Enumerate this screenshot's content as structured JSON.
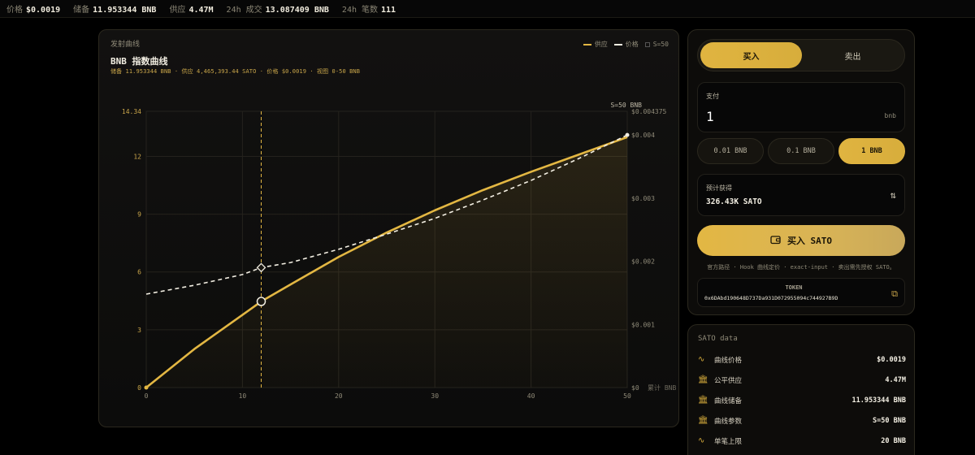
{
  "ticker": [
    {
      "label": "价格",
      "value": "$0.0019"
    },
    {
      "label": "储备",
      "value": "11.953344 BNB"
    },
    {
      "label": "供应",
      "value": "4.47M"
    },
    {
      "label": "24h 成交",
      "value": "13.087409 BNB"
    },
    {
      "label": "24h 笔数",
      "value": "111"
    }
  ],
  "chart_panel": {
    "tag": "发射曲线",
    "title": "BNB 指数曲线",
    "subtitle": "储备 11.953344 BNB · 供应 4,465,393.44 SATO · 价格 $0.0019 · 视图 0-50 BNB",
    "legend": {
      "supply": "供应",
      "price": "价格",
      "s": "S=50"
    },
    "top_right_label": "S=50 BNB"
  },
  "chart_data": {
    "type": "line",
    "x_range": [
      0,
      50
    ],
    "x_ticks": [
      0,
      10,
      20,
      30,
      40,
      50
    ],
    "y_left_range": [
      0,
      14.34
    ],
    "y_left_ticks": [
      "0",
      "3",
      "6",
      "9",
      "12",
      "14.34"
    ],
    "y_right_range": [
      0,
      0.004375
    ],
    "y_right_ticks": [
      "$0",
      "$0.001",
      "$0.002",
      "$0.003",
      "$0.004",
      "$0.004375"
    ],
    "x_axis_unit": "累计 BNB",
    "current_x": 11.95,
    "series": [
      {
        "name": "供应",
        "axis": "left",
        "style": "solid",
        "color": "#e3b743",
        "x": [
          0,
          5,
          10,
          11.95,
          15,
          20,
          25,
          30,
          35,
          40,
          45,
          50
        ],
        "y": [
          0,
          2.0,
          3.77,
          4.47,
          5.35,
          6.78,
          8.05,
          9.2,
          10.25,
          11.2,
          12.1,
          13.0
        ]
      },
      {
        "name": "价格",
        "axis": "right",
        "style": "dashed",
        "color": "#f2eee2",
        "x": [
          0,
          5,
          10,
          11.95,
          15,
          20,
          25,
          30,
          35,
          40,
          45,
          50
        ],
        "y": [
          0.00148,
          0.00162,
          0.00179,
          0.0019,
          0.00198,
          0.00219,
          0.00243,
          0.00268,
          0.00297,
          0.00328,
          0.00363,
          0.004
        ]
      }
    ]
  },
  "trade": {
    "tabs": {
      "buy": "买入",
      "sell": "卖出"
    },
    "pay_label": "支付",
    "pay_value": "1",
    "pay_unit": "bnb",
    "chips": [
      "0.01 BNB",
      "0.1 BNB",
      "1 BNB"
    ],
    "est_label": "预计获得",
    "est_value": "326.43K SATO",
    "buy_button": "买入 SATO",
    "note": "官方路径 · Hook 曲线定价 · exact-input · 卖出需先授权 SATO。",
    "token_label": "TOKEN",
    "token_address": "0x6DAbd190648D737Da931D072955094c744927B9D"
  },
  "data_panel": {
    "title": "SATO data",
    "rows": [
      {
        "label": "曲线价格",
        "value": "$0.0019"
      },
      {
        "label": "公平供应",
        "value": "4.47M"
      },
      {
        "label": "曲线储备",
        "value": "11.953344 BNB"
      },
      {
        "label": "曲线参数",
        "value": "S=50 BNB"
      },
      {
        "label": "单笔上限",
        "value": "20 BNB"
      }
    ]
  },
  "colors": {
    "accent": "#e3b743",
    "panel_bg": "#0d0c0a",
    "border": "#2b281e",
    "text": "#d6d0c0"
  },
  "icons": {
    "pulse": "activity-icon",
    "bank": "bank-icon",
    "wallet": "wallet-icon",
    "swap": "swap-vertical-icon",
    "copy": "copy-icon"
  }
}
